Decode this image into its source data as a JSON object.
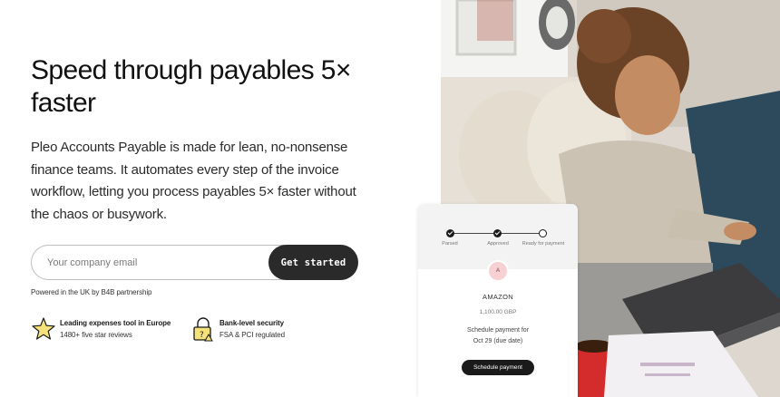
{
  "hero": {
    "headline": "Speed through payables 5× faster",
    "description": "Pleo Accounts Payable is made for lean, no-nonsense finance teams. It automates every step of the invoice workflow, letting you process payables 5× faster without the chaos or busywork."
  },
  "signup": {
    "email_placeholder": "Your company email",
    "email_value": "",
    "button_label": "Get started",
    "powered_by": "Powered in the UK by B4B partnership"
  },
  "badges": [
    {
      "title": "Leading expenses tool in Europe",
      "subtitle": "1480+ five star reviews",
      "icon": "star-icon"
    },
    {
      "title": "Bank-level security",
      "subtitle": "FSA & PCI regulated",
      "icon": "lock-icon"
    }
  ],
  "invoice_card": {
    "steps": [
      {
        "label": "Parsed",
        "state": "done"
      },
      {
        "label": "Approved",
        "state": "done"
      },
      {
        "label": "Ready for payment",
        "state": "open"
      }
    ],
    "avatar_letter": "A",
    "vendor": "AMAZON",
    "amount": "1,100.00 GBP",
    "schedule_line1": "Schedule payment for",
    "schedule_line2": "Oct 29 (due date)",
    "button_label": "Schedule payment"
  },
  "colors": {
    "button_dark": "#2a2a2a",
    "star_yellow": "#f6e27a",
    "avatar_pink": "#f7d0d3"
  }
}
